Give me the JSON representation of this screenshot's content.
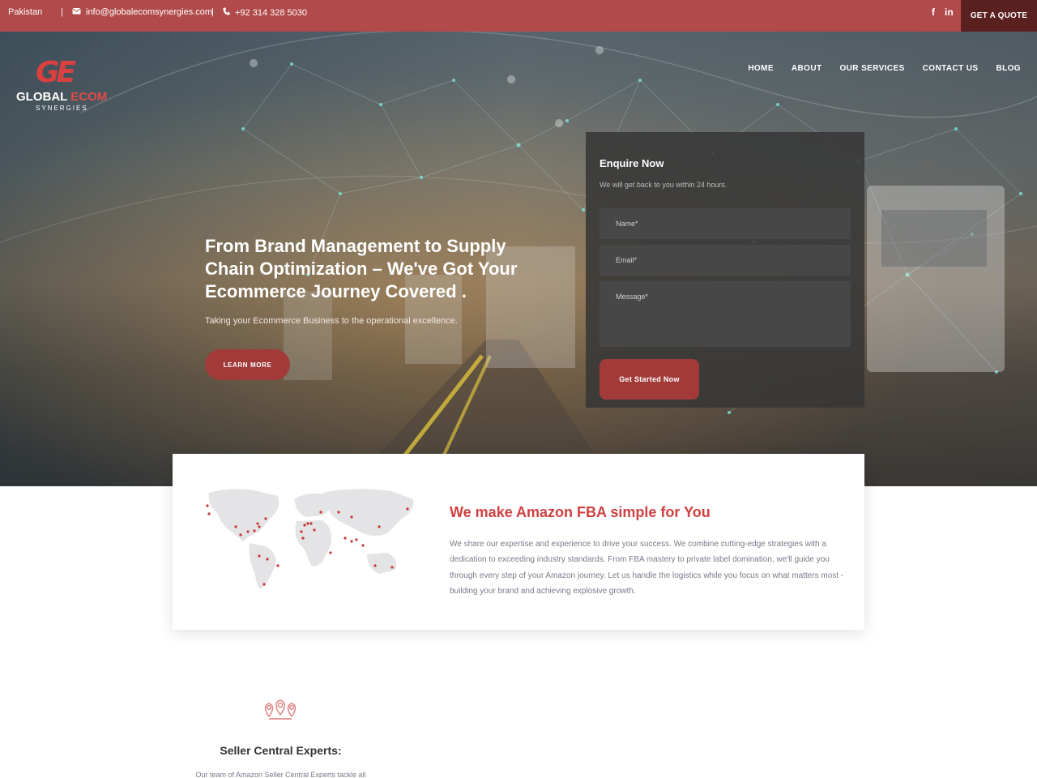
{
  "topbar": {
    "country": "Pakistan",
    "email": "info@globalecomsynergies.com",
    "phone": "+92 314 328 5030",
    "social_facebook": "f",
    "social_linkedin": "in",
    "quote_label": "GET A QUOTE"
  },
  "logo": {
    "mark": "GE",
    "brand_part1": "GLOBAL",
    "brand_part2": "ECOM",
    "brand_sub": "SYNERGIES"
  },
  "nav": {
    "items": [
      "HOME",
      "ABOUT",
      "OUR SERVICES",
      "CONTACT US",
      "BLOG"
    ]
  },
  "hero": {
    "title": "From Brand Management to Supply Chain Optimization – We've Got Your Ecommerce Journey Covered .",
    "subtitle": "Taking your Ecommerce Business to the operational excellence.",
    "learn_more_label": "LEARN MORE"
  },
  "enquire": {
    "title": "Enquire Now",
    "subtitle": "We will get back to you within 24 hours.",
    "name_placeholder": "Name*",
    "email_placeholder": "Email*",
    "message_placeholder": "Message*",
    "submit_label": "Get Started Now"
  },
  "about": {
    "title": "We make Amazon FBA simple for You",
    "text": "We share our expertise and experience to drive your success. We combine cutting-edge strategies with a dedication to exceeding industry standards. From FBA mastery to private label domination, we'll guide you through every step of your Amazon journey. Let us handle the logistics while you focus on what matters most - building your brand and achieving explosive growth."
  },
  "feature": {
    "icon": "location-pins-icon",
    "title": "Seller Central Experts:",
    "text": "Our team of Amazon Seller Central Experts tackle all"
  },
  "colors": {
    "accent": "#a23a3a",
    "topbar": "#b14a4a",
    "heading_red": "#d04040"
  }
}
